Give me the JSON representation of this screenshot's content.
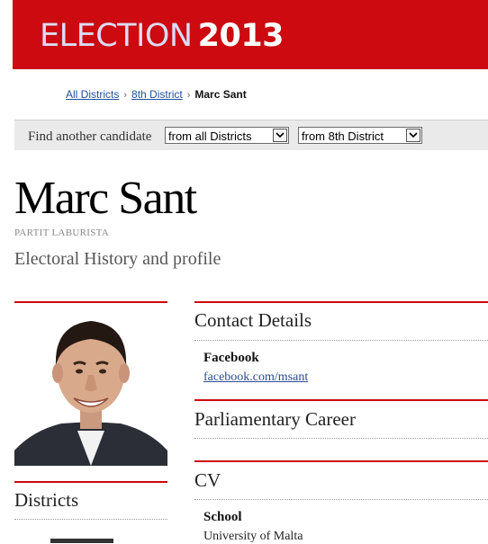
{
  "banner": {
    "word": "ELECTION",
    "year": "2013"
  },
  "breadcrumb": {
    "items": [
      "All Districts",
      "8th District"
    ],
    "current": "Marc Sant"
  },
  "finder": {
    "label": "Find another candidate",
    "select_all": "from all Districts",
    "select_district": "from 8th District"
  },
  "candidate": {
    "name": "Marc Sant",
    "party": "PARTIT LABURISTA",
    "subtitle": "Electoral History and profile"
  },
  "left": {
    "districts_heading": "Districts"
  },
  "contact": {
    "heading": "Contact Details",
    "facebook_label": "Facebook",
    "facebook_link": "facebook.com/msant"
  },
  "career": {
    "heading": "Parliamentary Career"
  },
  "cv": {
    "heading": "CV",
    "school_label": "School",
    "school_value": "University of Malta"
  },
  "colors": {
    "brand_red": "#cc0a0f",
    "link_blue": "#1e4f9c"
  }
}
